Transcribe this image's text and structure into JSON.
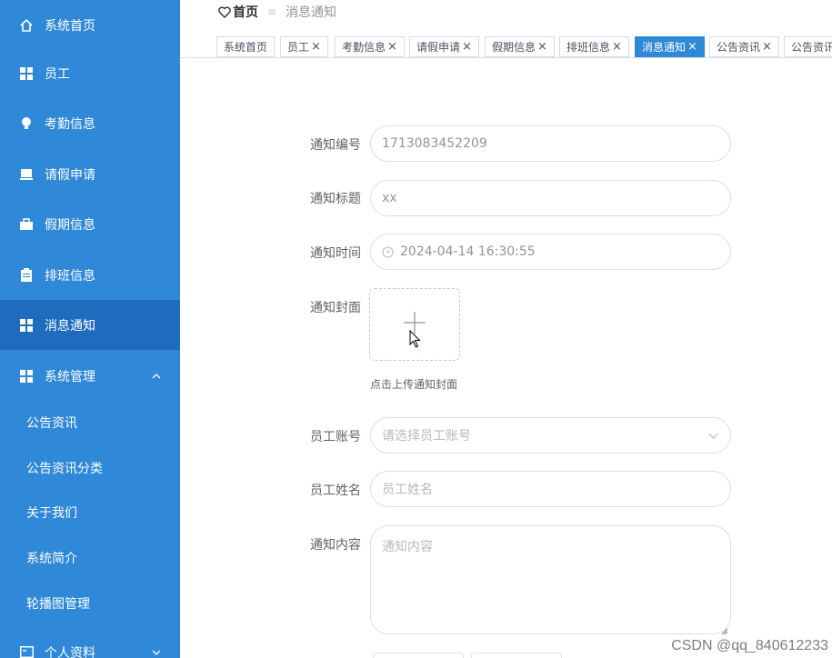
{
  "sidebar": {
    "items": [
      {
        "label": "系统首页",
        "icon": "home-icon"
      },
      {
        "label": "员工",
        "icon": "grid-icon"
      },
      {
        "label": "考勤信息",
        "icon": "bulb-icon"
      },
      {
        "label": "请假申请",
        "icon": "laptop-icon"
      },
      {
        "label": "假期信息",
        "icon": "briefcase-icon"
      },
      {
        "label": "排班信息",
        "icon": "clipboard-icon"
      },
      {
        "label": "消息通知",
        "icon": "grid-icon",
        "active": true
      },
      {
        "label": "系统管理",
        "icon": "grid-icon",
        "expanded": true
      }
    ],
    "subitems": [
      {
        "label": "公告资讯"
      },
      {
        "label": "公告资讯分类"
      },
      {
        "label": "关于我们"
      },
      {
        "label": "系统简介"
      },
      {
        "label": "轮播图管理"
      }
    ],
    "last_item": {
      "label": "个人资料",
      "icon": "id-card-icon"
    }
  },
  "breadcrumb": {
    "home": "首页",
    "current": "消息通知"
  },
  "tabs": [
    {
      "label": "系统首页",
      "closable": false
    },
    {
      "label": "员工",
      "closable": true
    },
    {
      "label": "考勤信息",
      "closable": true
    },
    {
      "label": "请假申请",
      "closable": true
    },
    {
      "label": "假期信息",
      "closable": true
    },
    {
      "label": "排班信息",
      "closable": true
    },
    {
      "label": "消息通知",
      "closable": true,
      "active": true
    },
    {
      "label": "公告资讯",
      "closable": true
    },
    {
      "label": "公告资讯",
      "closable": false
    }
  ],
  "form": {
    "notice_no": {
      "label": "通知编号",
      "value": "1713083452209"
    },
    "notice_title": {
      "label": "通知标题",
      "value": "xx"
    },
    "notice_time": {
      "label": "通知时间",
      "value": "2024-04-14 16:30:55"
    },
    "notice_cover": {
      "label": "通知封面",
      "tip": "点击上传通知封面"
    },
    "employee_account": {
      "label": "员工账号",
      "placeholder": "请选择员工账号"
    },
    "employee_name": {
      "label": "员工姓名",
      "placeholder": "员工姓名"
    },
    "notice_content": {
      "label": "通知内容",
      "placeholder": "通知内容"
    }
  },
  "watermark": "CSDN @qq_840612233",
  "colors": {
    "sidebar_bg": "#2f88d8",
    "sidebar_active": "#1f6cbf",
    "tab_active": "#2f88d8"
  }
}
